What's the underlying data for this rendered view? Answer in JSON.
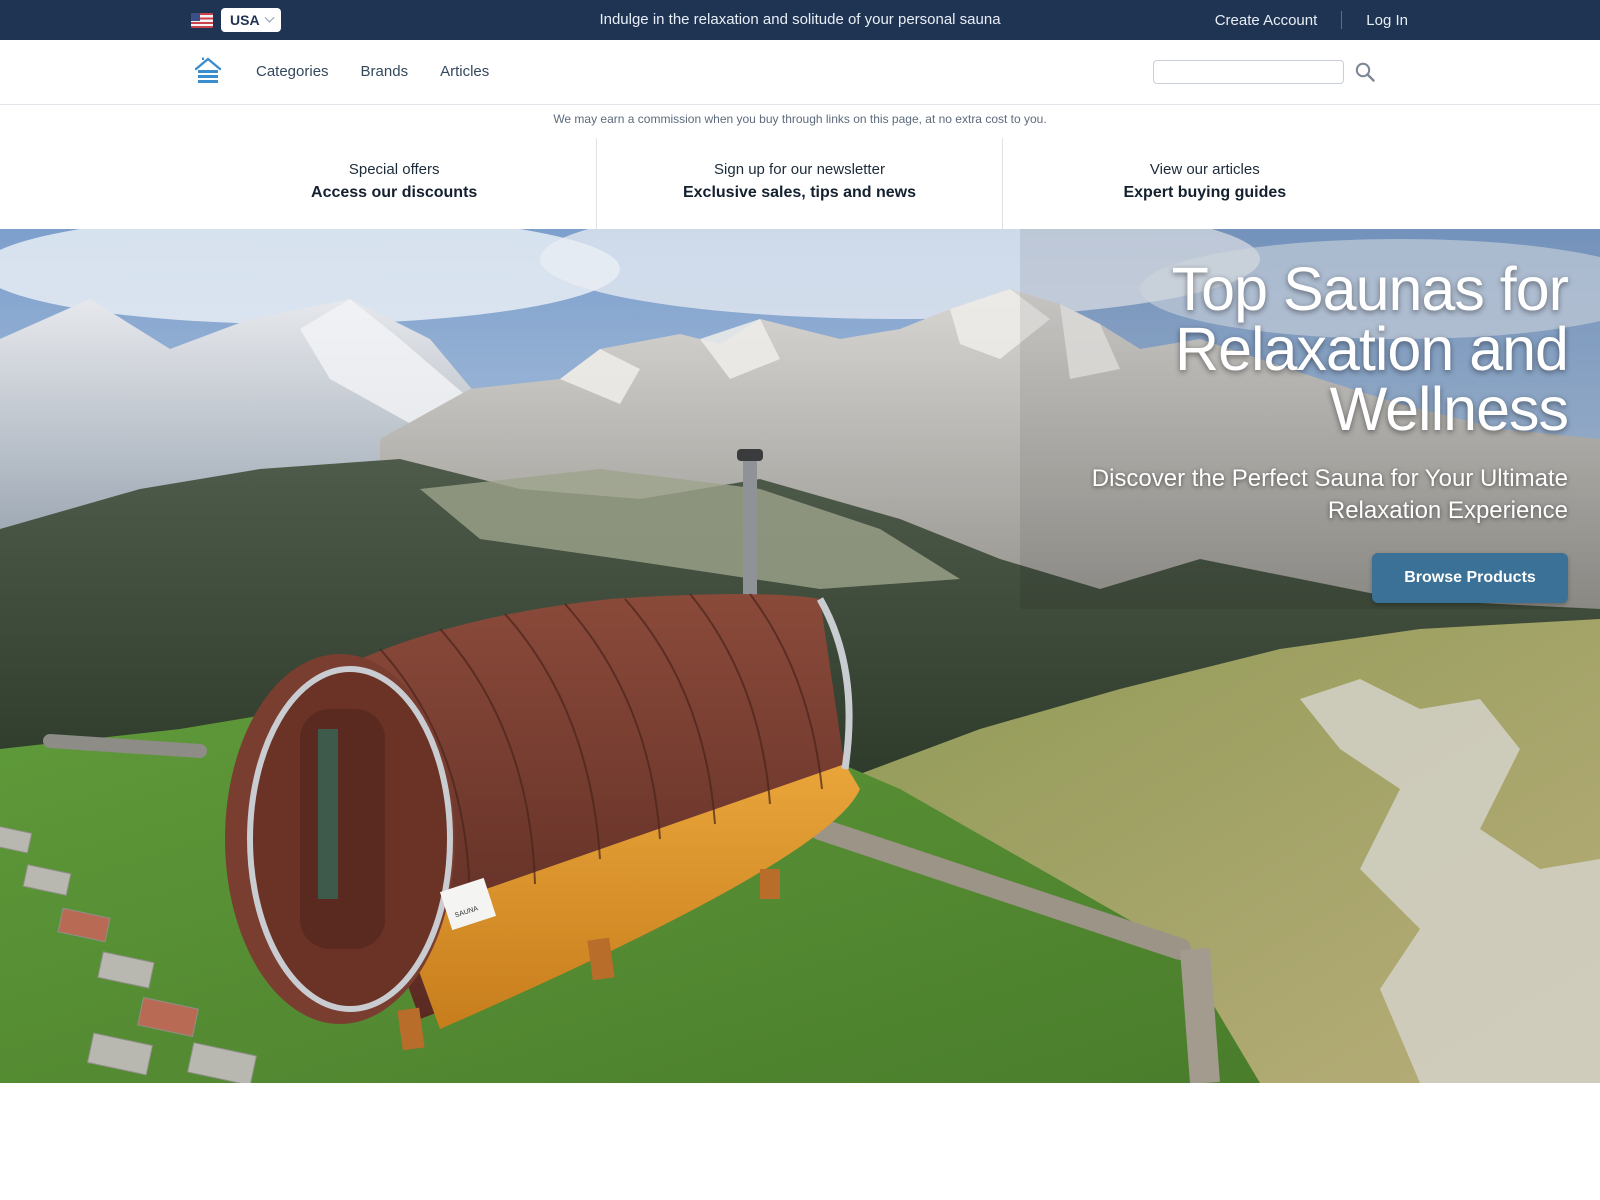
{
  "topbar": {
    "country": "USA",
    "flag_icon": "us-flag-icon",
    "tagline": "Indulge in the relaxation and solitude of your personal sauna",
    "create_account": "Create Account",
    "log_in": "Log In"
  },
  "nav": {
    "logo_icon": "house-icon",
    "links": [
      "Categories",
      "Brands",
      "Articles"
    ],
    "search": {
      "value": "",
      "placeholder": ""
    },
    "search_icon": "search-icon"
  },
  "disclaimer": "We may earn a commission when you buy through links on this page, at no extra cost to you.",
  "promos": [
    {
      "small": "Special offers",
      "big": "Access our discounts"
    },
    {
      "small": "Sign up for our newsletter",
      "big": "Exclusive sales, tips and news"
    },
    {
      "small": "View our articles",
      "big": "Expert buying guides"
    }
  ],
  "hero": {
    "title": "Top Saunas for Relaxation and Wellness",
    "subtitle": "Discover the Perfect Sauna for Your Ultimate Relaxation Experience",
    "button": "Browse Products",
    "sauna_sign": "SAUNA"
  },
  "colors": {
    "topbar": "#1f3352",
    "button": "#3b7196",
    "accent_logo": "#3a8ed0"
  }
}
